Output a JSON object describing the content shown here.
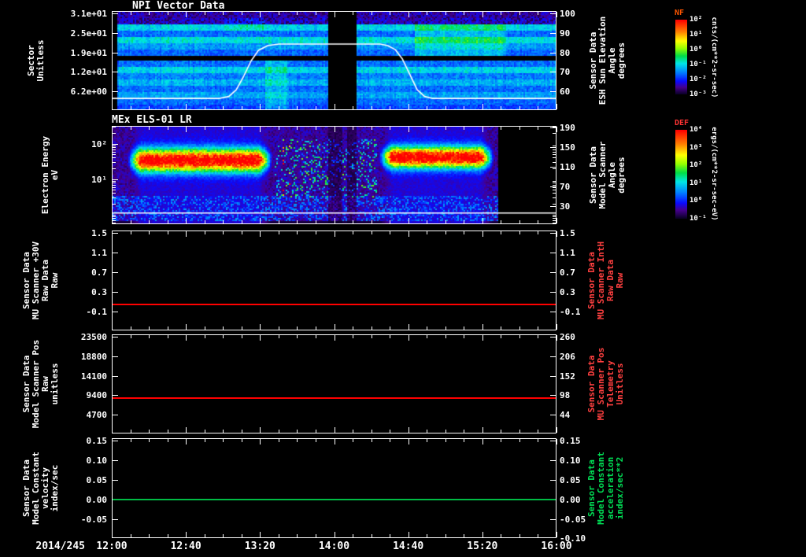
{
  "chart_data": {
    "type": "multi-panel-timeseries",
    "x_axis": {
      "date_label": "2014/245",
      "tick_labels": [
        "12:00",
        "12:40",
        "13:20",
        "14:00",
        "14:40",
        "15:20",
        "16:00"
      ],
      "start_min": 0,
      "end_min": 240,
      "minor_ticks_per_major": 4
    },
    "colormap_stops": [
      [
        0,
        [
          5,
          0,
          30
        ]
      ],
      [
        0.1,
        [
          70,
          0,
          140
        ]
      ],
      [
        0.18,
        [
          10,
          10,
          255
        ]
      ],
      [
        0.3,
        [
          0,
          130,
          255
        ]
      ],
      [
        0.42,
        [
          0,
          230,
          230
        ]
      ],
      [
        0.52,
        [
          0,
          220,
          70
        ]
      ],
      [
        0.62,
        [
          150,
          255,
          0
        ]
      ],
      [
        0.72,
        [
          255,
          255,
          0
        ]
      ],
      [
        0.84,
        [
          255,
          130,
          0
        ]
      ],
      [
        1,
        [
          255,
          0,
          0
        ]
      ]
    ],
    "colorbars": [
      {
        "name": "NF",
        "name_color": "#ff5500",
        "units": "cnts/(cm**2-sr-sec)",
        "tick_labels": [
          "10²",
          "10¹",
          "10⁰",
          "10⁻¹",
          "10⁻²",
          "10⁻³"
        ]
      },
      {
        "name": "DEF",
        "name_color": "#ff3333",
        "units": "ergs/(cm**2-sr-sec-eV)",
        "tick_labels": [
          "10⁴",
          "10³",
          "10²",
          "10¹",
          "10⁰",
          "10⁻¹"
        ]
      }
    ],
    "panels": [
      {
        "id": "npi",
        "type": "heatmap",
        "title": "NPI Vector Data",
        "left_axis": {
          "label_lines": [
            "Sector",
            "Unitless"
          ],
          "color": "#ffffff",
          "ticks": [
            {
              "label": "3.1e+01",
              "frac": 0.024
            },
            {
              "label": "2.5e+01",
              "frac": 0.221
            },
            {
              "label": "1.9e+01",
              "frac": 0.418
            },
            {
              "label": "1.2e+01",
              "frac": 0.615
            },
            {
              "label": "6.2e+00",
              "frac": 0.812
            }
          ]
        },
        "right_axis": {
          "label_lines": [
            "Sensor Data",
            "ESH Sun Elevation",
            "Angle",
            "degrees"
          ],
          "color": "#ffffff",
          "ticks": [
            {
              "label": "100",
              "frac": 0.024
            },
            {
              "label": "90",
              "frac": 0.221
            },
            {
              "label": "80",
              "frac": 0.418
            },
            {
              "label": "70",
              "frac": 0.615
            },
            {
              "label": "60",
              "frac": 0.812
            }
          ]
        },
        "heatmap": {
          "row_intensities": [
            0.13,
            0.15,
            0.4,
            0.28,
            0.42,
            0.33,
            0.27,
            0,
            0.28,
            0.4,
            0.3,
            0.36,
            0.28,
            0.34,
            0.28,
            0.24
          ],
          "gaps_min": [
            [
              0,
              2.5
            ],
            [
              116,
              131.5
            ]
          ],
          "bright_patches": [
            {
              "t": [
                163,
                213
              ],
              "rows": [
                2,
                7
              ],
              "boost": 0.1
            },
            {
              "t": [
                82,
                94
              ],
              "rows": [
                8,
                16
              ],
              "boost": 0.08
            },
            {
              "t": [
                60,
                82
              ],
              "rows": [
                1,
                3
              ],
              "boost": 0.05
            }
          ],
          "noise": 0.05
        },
        "overlay_line": {
          "name": "ESH Sun Elevation Angle",
          "color": "#ffffff",
          "axis_range": [
            101.6,
            50.8
          ],
          "points_min_value": [
            [
              0,
              56.5
            ],
            [
              58,
              56.5
            ],
            [
              63,
              57.5
            ],
            [
              67,
              61
            ],
            [
              71,
              68
            ],
            [
              75,
              76
            ],
            [
              79,
              81.5
            ],
            [
              84,
              84
            ],
            [
              90,
              84.8
            ],
            [
              145,
              84.8
            ],
            [
              149,
              84
            ],
            [
              153,
              82
            ],
            [
              157,
              77
            ],
            [
              161,
              69
            ],
            [
              165,
              61
            ],
            [
              169,
              57.5
            ],
            [
              173,
              56.5
            ],
            [
              240,
              56.5
            ]
          ]
        }
      },
      {
        "id": "els",
        "type": "heatmap",
        "title": "MEx ELS-01 LR",
        "left_axis": {
          "label_lines": [
            "Electron Energy",
            "eV"
          ],
          "color": "#ffffff",
          "ticks": [
            {
              "label": "10²",
              "frac": 0.18
            },
            {
              "label": "10¹",
              "frac": 0.54
            }
          ],
          "minor_tick_fracs": [
            0.008,
            0.072,
            0.197,
            0.215,
            0.236,
            0.26,
            0.288,
            0.323,
            0.368,
            0.432,
            0.557,
            0.575,
            0.596,
            0.62,
            0.648,
            0.683,
            0.728,
            0.792,
            0.9,
            0.917,
            0.935,
            0.956,
            0.98
          ]
        },
        "right_axis": {
          "label_lines": [
            "Sensor Data",
            "Model Scanner",
            "Angle",
            "degrees"
          ],
          "color": "#ffffff",
          "ticks": [
            {
              "label": "190",
              "frac": 0.016
            },
            {
              "label": "150",
              "frac": 0.216
            },
            {
              "label": "110",
              "frac": 0.416
            },
            {
              "label": "70",
              "frac": 0.616
            },
            {
              "label": "30",
              "frac": 0.816
            }
          ]
        },
        "heatmap": {
          "bands": [
            {
              "t": [
                7,
                87
              ],
              "center_frac": 0.34,
              "width_frac": 0.115,
              "amp": 0.92
            },
            {
              "t": [
                143,
                207
              ],
              "center_frac": 0.31,
              "width_frac": 0.105,
              "amp": 0.92
            }
          ],
          "data_end_min": 208.5,
          "dim_region": {
            "t": [
              87,
              143
            ],
            "speckle_prob": 0.2
          },
          "dark_columns": [
            [
              116,
              124
            ],
            [
              127,
              132
            ]
          ],
          "white_line_frac": 0.885
        }
      },
      {
        "id": "mu-scanner-30v",
        "type": "line",
        "left_axis": {
          "label_lines": [
            "Sensor Data",
            "MU Scanner +30V",
            "Raw Data",
            "Raw"
          ],
          "color": "#ffffff",
          "range": [
            1.549,
            -0.482
          ],
          "tick_values": [
            1.5,
            1.1,
            0.7,
            0.3,
            -0.1
          ],
          "tick_labels": [
            "1.5",
            "1.1",
            "0.7",
            "0.3",
            "-0.1"
          ]
        },
        "right_axis": {
          "label_lines": [
            "Sensor Data",
            "MU Scanner IntH",
            "Raw Data",
            "Raw"
          ],
          "color": "#ff4040",
          "range": [
            1.549,
            -0.482
          ],
          "tick_values": [
            1.5,
            1.1,
            0.7,
            0.3,
            -0.1
          ],
          "tick_labels": [
            "1.5",
            "1.1",
            "0.7",
            "0.3",
            "-0.1"
          ]
        },
        "series": [
          {
            "name": "MU Scanner +30V Raw",
            "color": "#ff0000",
            "constant_value": 0.05,
            "axis": "left"
          }
        ]
      },
      {
        "id": "model-scanner-pos",
        "type": "line",
        "left_axis": {
          "label_lines": [
            "Sensor Data",
            "Model Scanner Pos",
            "Raw",
            "unitless"
          ],
          "color": "#ffffff",
          "range": [
            24072,
            216
          ],
          "tick_values": [
            23500,
            18800,
            14100,
            9400,
            4700
          ],
          "tick_labels": [
            "23500",
            "18800",
            "14100",
            "9400",
            "4700"
          ]
        },
        "right_axis": {
          "label_lines": [
            "Sensor Data",
            "MU Scanner Pos",
            "Telemetry",
            "Unitless"
          ],
          "color": "#ff4040",
          "range": [
            266.6,
            -7.6
          ],
          "tick_values": [
            260,
            206,
            152,
            98,
            44
          ],
          "tick_labels": [
            "260",
            "206",
            "152",
            "98",
            "44"
          ]
        },
        "series": [
          {
            "name": "Model Scanner Pos Raw",
            "color": "#ff0000",
            "constant_value": 8650,
            "axis": "left"
          }
        ]
      },
      {
        "id": "model-constant",
        "type": "line",
        "left_axis": {
          "label_lines": [
            "Sensor Data",
            "Model Constant",
            "velocity",
            "index/sec"
          ],
          "color": "#ffffff",
          "range": [
            0.156,
            -0.098
          ],
          "tick_values": [
            0.15,
            0.1,
            0.05,
            0,
            -0.05
          ],
          "tick_labels": [
            "0.15",
            "0.10",
            "0.05",
            "0.00",
            "-0.05"
          ]
        },
        "right_axis": {
          "label_lines": [
            "Sensor Data",
            "Model Constant",
            "acceleration",
            "index/sec**2"
          ],
          "color": "#00dd55",
          "range": [
            0.156,
            -0.098
          ],
          "tick_values": [
            0.15,
            0.1,
            0.05,
            0,
            -0.05,
            -0.1
          ],
          "tick_labels": [
            "0.15",
            "0.10",
            "0.05",
            "0.00",
            "-0.05",
            "-0.10"
          ]
        },
        "series": [
          {
            "name": "Model Constant velocity",
            "color": "#00bb44",
            "constant_value": 0,
            "axis": "left"
          }
        ]
      }
    ]
  }
}
